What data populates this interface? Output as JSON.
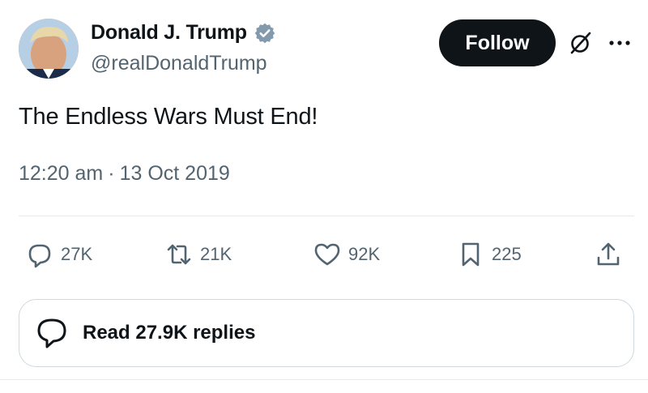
{
  "author": {
    "display_name": "Donald J. Trump",
    "handle": "@realDonaldTrump",
    "verified": true,
    "verified_color": "#829aab"
  },
  "follow_label": "Follow",
  "tweet": {
    "text": "The Endless Wars Must End!",
    "time": "12:20 am",
    "separator": "·",
    "date": "13 Oct 2019"
  },
  "actions": {
    "replies": "27K",
    "retweets": "21K",
    "likes": "92K",
    "bookmarks": "225"
  },
  "read_replies_label": "Read 27.9K replies",
  "colors": {
    "text_primary": "#0f1419",
    "text_secondary": "#536471",
    "button_bg": "#0f1419",
    "border": "#cfd9de"
  },
  "icons": [
    "grok-icon",
    "more-icon",
    "reply-icon",
    "retweet-icon",
    "like-icon",
    "bookmark-icon",
    "share-icon",
    "chat-bubble-icon",
    "verified-badge-icon"
  ]
}
